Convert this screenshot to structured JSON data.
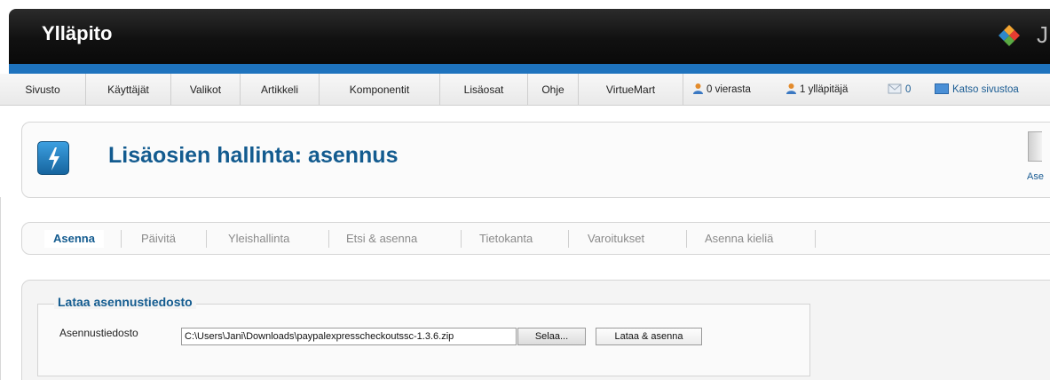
{
  "header": {
    "title": "Ylläpito",
    "logo_letter": "J"
  },
  "menu": {
    "items": [
      "Sivusto",
      "Käyttäjät",
      "Valikot",
      "Artikkeli",
      "Komponentit",
      "Lisäosat",
      "Ohje",
      "VirtueMart"
    ],
    "visitors": "0 vierasta",
    "admins": "1 ylläpitäjä",
    "messages": "0",
    "view_site": "Katso sivustoa"
  },
  "page": {
    "title": "Lisäosien hallinta: asennus",
    "toolbar_label": "Ase"
  },
  "tabs": [
    "Asenna",
    "Päivitä",
    "Yleishallinta",
    "Etsi & asenna",
    "Tietokanta",
    "Varoitukset",
    "Asenna kieliä"
  ],
  "upload": {
    "legend": "Lataa asennustiedosto",
    "label": "Asennustiedosto",
    "file_value": "C:\\Users\\Jani\\Downloads\\paypalexpresscheckoutssc-1.3.6.zip",
    "browse_label": "Selaa...",
    "install_label": "Lataa & asenna"
  },
  "colors": {
    "accent": "#135b8f",
    "header_strip": "#1e73be"
  }
}
